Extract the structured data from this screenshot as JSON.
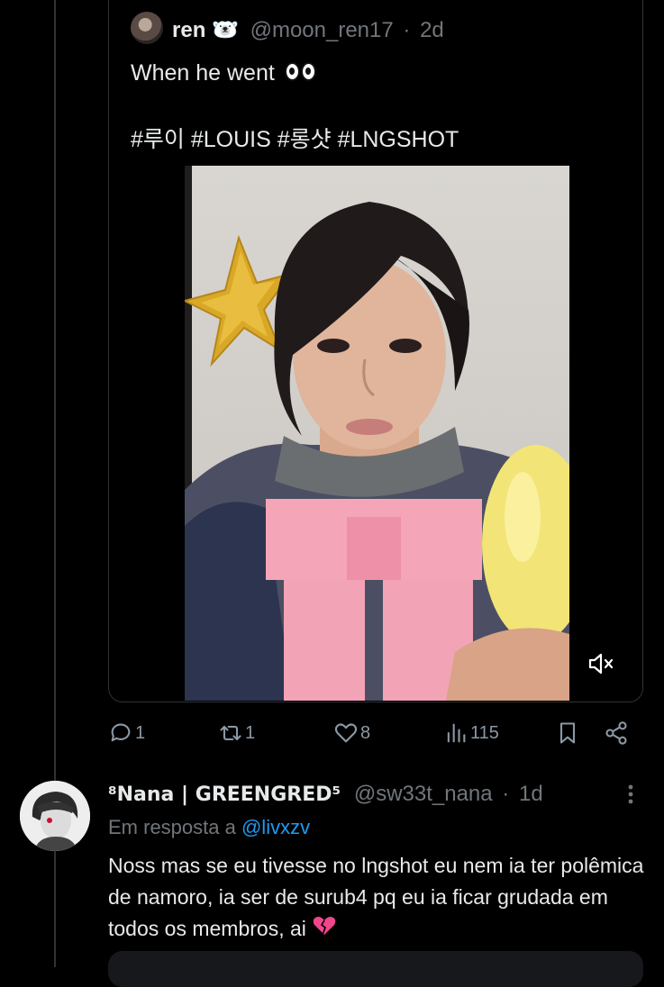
{
  "quoted_tweet": {
    "display_name": "ren",
    "name_emoji": "🐻‍❄️",
    "handle": "@moon_ren17",
    "separator": "·",
    "time": "2d",
    "text_line1": "When he went",
    "hashtags": "#루이 #LOUIS #롱샷 #LNGSHOT",
    "media_icon": "mute-icon"
  },
  "actions": {
    "replies": "1",
    "reposts": "1",
    "likes": "8",
    "views": "115"
  },
  "reply": {
    "display_name": "⁸Nana | GREENGRED⁵",
    "handle": "@sw33t_nana",
    "separator": "·",
    "time": "1d",
    "reply_prefix": "Em resposta a",
    "reply_mention": "@livxzv",
    "body": "Noss mas se eu tivesse no lngshot eu nem ia ter polêmica de namoro, ia ser de surub4 pq eu ia ficar grudada em todos os membros, ai"
  },
  "colors": {
    "background": "#000000",
    "text": "#e7e9ea",
    "muted": "#71767b",
    "link": "#1d9bf0",
    "border": "#2f3336"
  }
}
